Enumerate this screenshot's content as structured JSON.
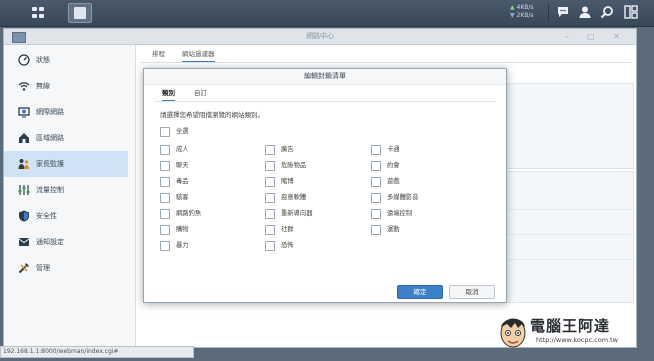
{
  "taskbar": {
    "upload_speed": "4KB/s",
    "download_speed": "2KB/s",
    "icons": [
      "main-menu-icon",
      "control-panel-app-icon",
      "notification-chat-icon",
      "user-icon",
      "search-icon",
      "widgets-icon"
    ]
  },
  "window": {
    "title": "網路中心",
    "controls": "– □ ✕"
  },
  "sidebar": {
    "items": [
      {
        "label": "狀態",
        "icon": "speedometer-icon"
      },
      {
        "label": "無線",
        "icon": "wifi-icon"
      },
      {
        "label": "網際網路",
        "icon": "globe-icon"
      },
      {
        "label": "區域網路",
        "icon": "home-network-icon"
      },
      {
        "label": "家長監護",
        "icon": "family-icon"
      },
      {
        "label": "流量控制",
        "icon": "traffic-control-icon"
      },
      {
        "label": "安全性",
        "icon": "shield-icon"
      },
      {
        "label": "通知設定",
        "icon": "notification-icon"
      },
      {
        "label": "管理",
        "icon": "tools-icon"
      }
    ],
    "active_index": 4
  },
  "content": {
    "tabs": [
      "排程",
      "網站過濾器"
    ],
    "active_tab": 1
  },
  "modal": {
    "title": "編輯封鎖清單",
    "tabs": [
      "類別",
      "自訂"
    ],
    "active_tab": 0,
    "instruction": "請選擇您希望阻擋瀏覽的網站類別。",
    "select_all": "全選",
    "categories": [
      [
        "成人",
        "廣告",
        "卡通"
      ],
      [
        "聊天",
        "危險物品",
        "約會"
      ],
      [
        "毒品",
        "賭博",
        "遊戲"
      ],
      [
        "駭客",
        "惡意軟體",
        "多媒體影音"
      ],
      [
        "網路釣魚",
        "重新導向器",
        "遠端控制"
      ],
      [
        "購物",
        "社群",
        "運動"
      ],
      [
        "暴力",
        "恐怖"
      ]
    ],
    "ok_button": "確定",
    "cancel_button": "取消"
  },
  "statusbar": {
    "url": "192.168.1.1:8000/webman/index.cgi#"
  },
  "watermark": {
    "text": "電腦王阿達",
    "url": "http://www.kocpc.com.tw"
  },
  "colors": {
    "accent": "#3d80c8",
    "active_nav": "#cfe3f4",
    "taskbar": "#394857"
  }
}
